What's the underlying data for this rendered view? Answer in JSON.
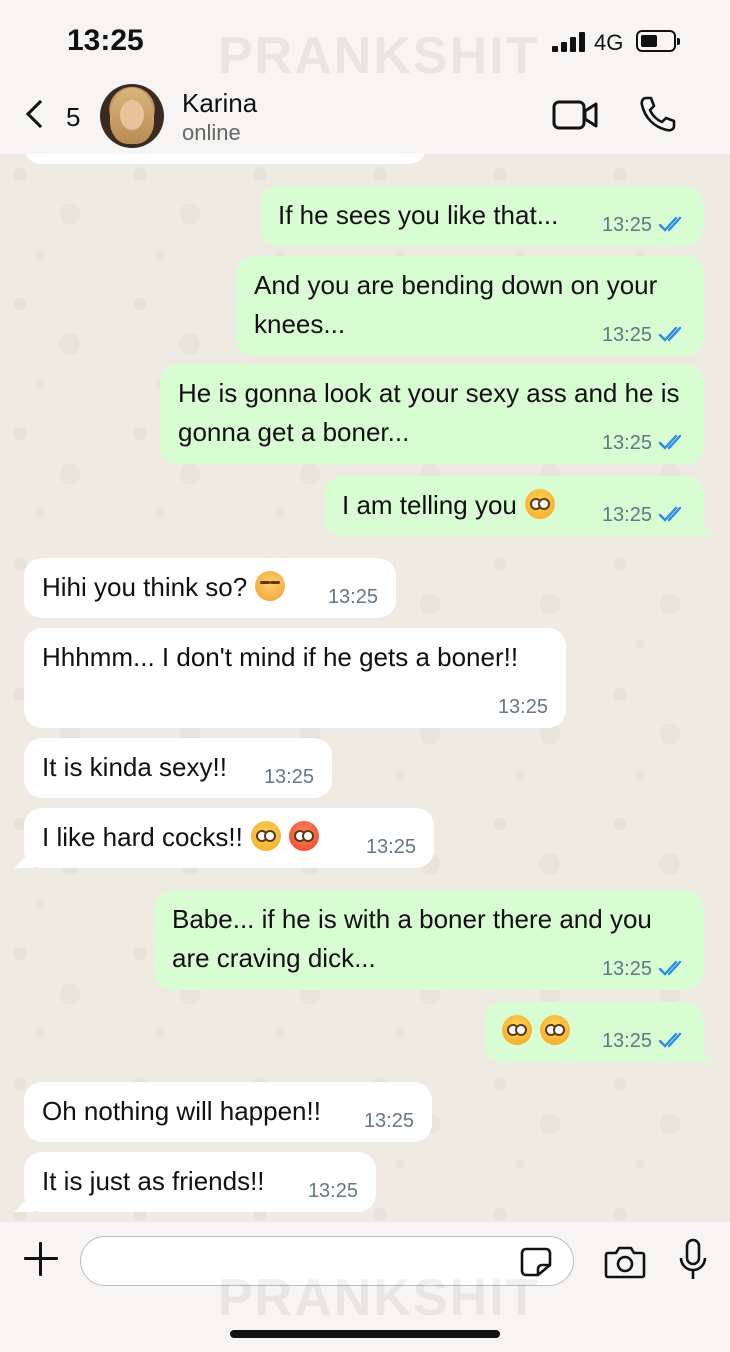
{
  "status_bar": {
    "time": "13:25",
    "network": "4G"
  },
  "watermark": "PRANKSHIT",
  "header": {
    "back_count": "5",
    "contact_name": "Karina",
    "contact_status": "online"
  },
  "messages": [
    {
      "dir": "out",
      "text": "If he sees you like that...",
      "time": "13:25",
      "read": true
    },
    {
      "dir": "out",
      "text": "And you are bending down on your knees...",
      "time": "13:25",
      "read": true
    },
    {
      "dir": "out",
      "text": "He is gonna look at your sexy ass and he is gonna get a boner...",
      "time": "13:25",
      "read": true
    },
    {
      "dir": "out",
      "text": "I am telling you",
      "emoji": [
        "flushed"
      ],
      "time": "13:25",
      "read": true
    },
    {
      "dir": "in",
      "text": "Hihi you think so?",
      "emoji": [
        "hand-over-mouth"
      ],
      "time": "13:25"
    },
    {
      "dir": "in",
      "text": "Hhhmm... I don't mind if he gets a boner!!",
      "time": "13:25"
    },
    {
      "dir": "in",
      "text": "It is kinda sexy!!",
      "time": "13:25"
    },
    {
      "dir": "in",
      "text": "I like hard cocks!!",
      "emoji": [
        "flushed",
        "hot-face"
      ],
      "time": "13:25"
    },
    {
      "dir": "out",
      "text": "Babe... if he is with a boner there and you are craving dick...",
      "time": "13:25",
      "read": true
    },
    {
      "dir": "out",
      "text": "",
      "emoji": [
        "flushed",
        "flushed"
      ],
      "time": "13:25",
      "read": true
    },
    {
      "dir": "in",
      "text": "Oh nothing will happen!!",
      "time": "13:25"
    },
    {
      "dir": "in",
      "text": "It is just as friends!!",
      "time": "13:25"
    }
  ],
  "composer": {
    "value": "",
    "placeholder": ""
  },
  "colors": {
    "outgoing_bubble": "#d9fdd3",
    "incoming_bubble": "#ffffff",
    "read_ticks": "#2a8be8",
    "chat_background": "#efeae2"
  },
  "icons": [
    "back-chevron-icon",
    "video-call-icon",
    "phone-icon",
    "plus-icon",
    "sticker-icon",
    "camera-icon",
    "mic-icon",
    "double-check-icon"
  ]
}
